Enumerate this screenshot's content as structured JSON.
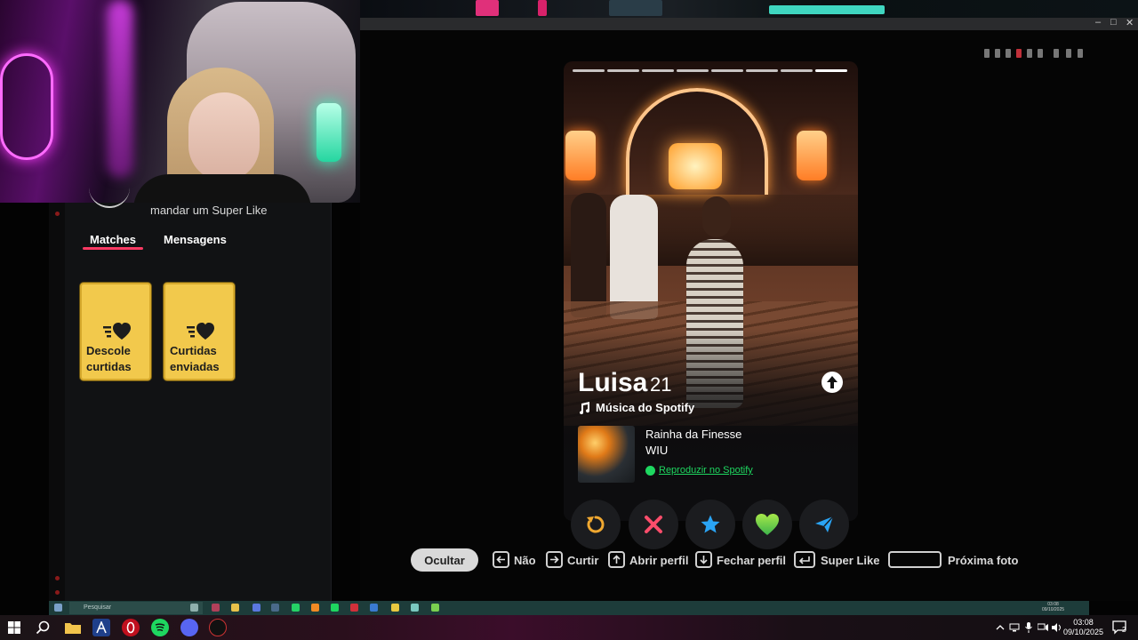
{
  "sidebar": {
    "superlike_hint": "mandar um Super Like",
    "tabs": [
      {
        "label": "Matches",
        "active": true
      },
      {
        "label": "Mensagens",
        "active": false
      }
    ],
    "cards": [
      {
        "label_line1": "Descole",
        "label_line2": "curtidas"
      },
      {
        "label_line1": "Curtidas",
        "label_line2": "enviadas"
      }
    ]
  },
  "profile": {
    "name": "Luisa",
    "age": "21",
    "photo_count": 8,
    "active_photo_index": 8,
    "spotify_header": "Música do Spotify",
    "track": "Rainha da Finesse",
    "artist": "WIU",
    "spotify_link": "Reproduzir no Spotify"
  },
  "actions": [
    {
      "name": "rewind",
      "icon": "rewind-icon",
      "color": "#f0a830"
    },
    {
      "name": "nope",
      "icon": "close-icon",
      "color": "#fd4d6b"
    },
    {
      "name": "super-like",
      "icon": "star-icon",
      "color": "#2aa4f4"
    },
    {
      "name": "like",
      "icon": "heart-icon",
      "color": "#7ed321"
    },
    {
      "name": "boost",
      "icon": "send-icon",
      "color": "#2aa4f4"
    }
  ],
  "hints": {
    "hide_button": "Ocultar",
    "nope": "Não",
    "like": "Curtir",
    "open_profile": "Abrir perfil",
    "close_profile": "Fechar perfil",
    "super_like": "Super Like",
    "next_photo": "Próxima foto"
  },
  "inner_taskbar": {
    "search_placeholder": "Pesquisar",
    "clock_time": "03:08",
    "clock_date": "09/10/2025"
  },
  "taskbar": {
    "time": "03:08",
    "date": "09/10/2025",
    "notification_count": "2"
  },
  "colors": {
    "tinder_pink": "#fd3a63",
    "gold_card": "#f2c94c",
    "spotify_green": "#1ed760"
  }
}
